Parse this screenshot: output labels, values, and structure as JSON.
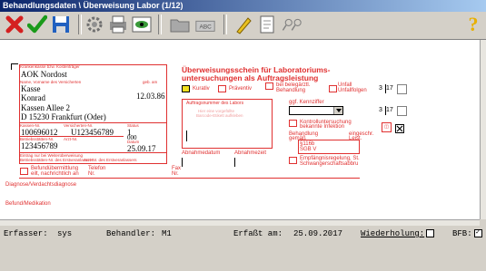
{
  "window": {
    "title": "Behandlungsdaten \\ Überweisung Labor (1/12)"
  },
  "toolbar": {
    "icons": [
      "close-icon",
      "checkmark-icon",
      "save-icon",
      "settings-icon",
      "print-icon",
      "preview-icon",
      "folder-icon",
      "abc-icon",
      "edit-icon",
      "document-icon",
      "zoom-icon",
      "help-icon"
    ]
  },
  "form": {
    "insurance_label": "Krankenkasse bzw. Kostenträger",
    "insurance_value": "AOK Nordost",
    "name_label": "Name, Vorname des Versicherten",
    "birth_label": "geb. am",
    "last_name": "Kasse",
    "first_name": "Konrad",
    "birth_date": "12.03.86",
    "street": "Kassen Allee 2",
    "city": "D 15230 Frankfurt (Oder)",
    "kassen_nr_label": "Kassen-Nr.",
    "versicherten_nr_label": "Versicherten-Nr.",
    "status_label": "Status",
    "kassen_nr": "100696012",
    "versicherten_nr": "U123456789",
    "status": "1",
    "status_extra": "000",
    "betriebsstaetten_label": "Betriebsstätten-Nr.",
    "arzt_nr_label": "Arzt-Nr.",
    "datum_label": "Datum",
    "betriebsstaetten_nr": "123456789",
    "datum": "25.09.17",
    "entry_label": "Eintrag nur bei Weiterüberweisung",
    "entry_sub1": "Betriebsstätten-Nr. des Erstveranlassers",
    "entry_sub2": "Arzt-Nr. des Erstveranlassers",
    "befund_label": "Befundübermittlung",
    "befund_sub": "eilt, nachrichtlich an",
    "telefon_label": "Telefon",
    "telefon_nr": "Nr.",
    "fax_label": "Fax",
    "fax_nr": "Nr.",
    "diagnose_label": "Diagnose/Verdachtsdiagnose",
    "befund_med_label": "Befund/Medikation",
    "header_line1": "Überweisungsschein für Laboratoriums-",
    "header_line2": "untersuchungen als Auftragsleistung",
    "kurativ": "Kurativ",
    "praeventiv": "Präventiv",
    "belegarzt": "bei belegärztl.",
    "belegarzt2": "Behandlung",
    "unfall": "Unfall",
    "unfall2": "Unfallfolgen",
    "quarter1": "3",
    "year1": "17",
    "quarter2": "3",
    "year2": "17",
    "auftrag_label": "Auftragsnummer des Labors",
    "auftrag_hint1": "Hier eine vorgefüllte",
    "auftrag_hint2": "Barcode-Etikett aufkleben",
    "kennziffer_label": "ggf. Kennziffer",
    "kontroll1": "Kontrolluntersuchung",
    "kontroll2": "bekannte Infektion",
    "behandlung1": "Behandlung",
    "behandlung2": "gemäß",
    "behandlung3": "§116b",
    "behandlung4": "SGB V",
    "empf1": "Empfängnisregelung, St.",
    "empf2": "Schwangerschaftsabbru",
    "ehe": "eingeschr.",
    "leist": "Leist.",
    "abnahmedatum": "Abnahmedatum",
    "abnahmezeit": "Abnahmezeit"
  },
  "status": {
    "erfasser_label": "Erfasser:",
    "erfasser_value": "sys",
    "behandler_label": "Behandler:",
    "behandler_value": "M1",
    "erfasst_label": "Erfaßt am:",
    "erfasst_value": "25.09.2017",
    "wiederholung_label": "Wiederholung:",
    "wiederholung_checked": false,
    "bfb_label": "BFB:",
    "bfb_checked": true
  }
}
